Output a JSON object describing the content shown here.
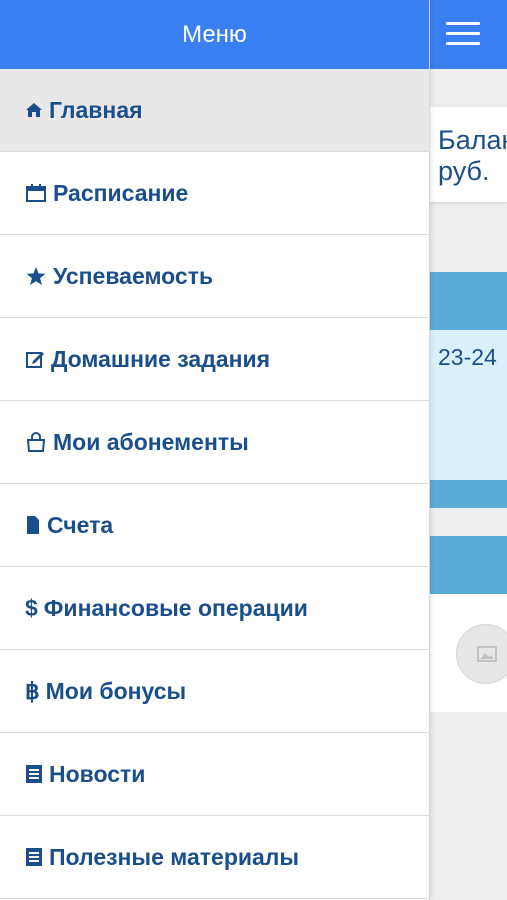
{
  "menu": {
    "title": "Меню",
    "items": [
      {
        "label": "Главная",
        "icon": "home-icon",
        "active": true
      },
      {
        "label": "Расписание",
        "icon": "calendar-icon"
      },
      {
        "label": "Успеваемость",
        "icon": "star-icon"
      },
      {
        "label": "Домашние задания",
        "icon": "edit-icon"
      },
      {
        "label": "Мои абонементы",
        "icon": "shopping-bag-icon"
      },
      {
        "label": "Счета",
        "icon": "document-icon"
      },
      {
        "label": "Финансовые операции",
        "icon": "dollar-icon"
      },
      {
        "label": "Мои бонусы",
        "icon": "baht-icon"
      },
      {
        "label": "Новости",
        "icon": "newspaper-icon"
      },
      {
        "label": "Полезные материалы",
        "icon": "book-icon"
      }
    ]
  },
  "background": {
    "balance_text": "Баланс",
    "balance_currency": "руб.",
    "schedule_time": "23-24"
  },
  "colors": {
    "header": "#3a7ff2",
    "menu_text": "#1b4f8c",
    "active_item": "#e8e8e8",
    "card_bar": "#5badd8",
    "card_bg": "#daf1fb"
  }
}
